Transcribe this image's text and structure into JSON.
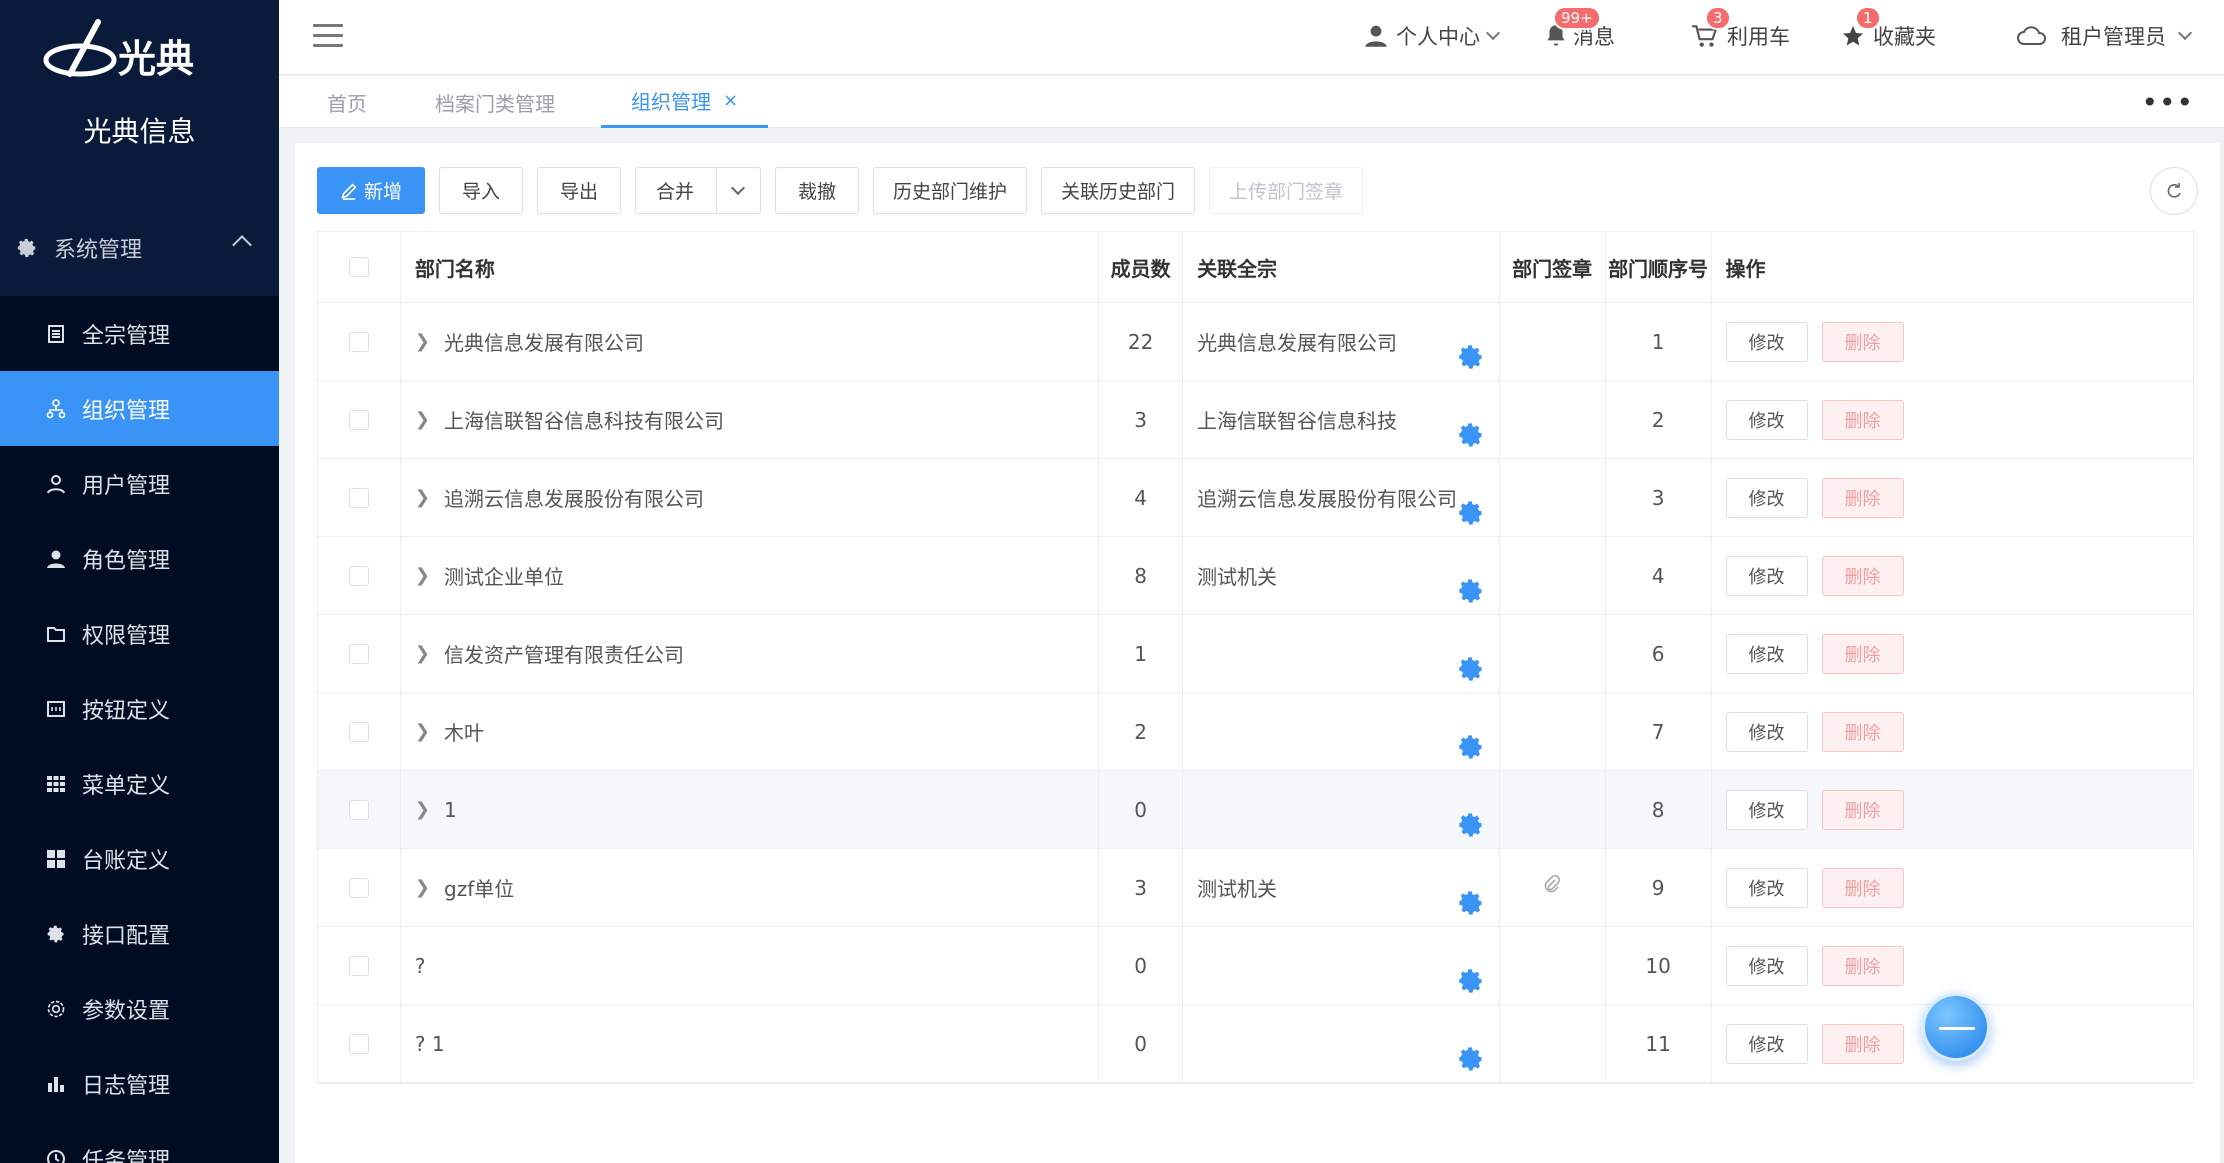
{
  "brand": {
    "logo_text": "光典",
    "name": "光典信息"
  },
  "sidebar": {
    "parent": {
      "label": "系统管理"
    },
    "items": [
      {
        "label": "全宗管理",
        "icon": "document-icon"
      },
      {
        "label": "组织管理",
        "icon": "org-chart-icon",
        "active": true
      },
      {
        "label": "用户管理",
        "icon": "user-outline-icon"
      },
      {
        "label": "角色管理",
        "icon": "user-filled-icon"
      },
      {
        "label": "权限管理",
        "icon": "folder-icon"
      },
      {
        "label": "按钮定义",
        "icon": "button-icon"
      },
      {
        "label": "菜单定义",
        "icon": "grid-icon"
      },
      {
        "label": "台账定义",
        "icon": "tiles-icon"
      },
      {
        "label": "接口配置",
        "icon": "gear-icon"
      },
      {
        "label": "参数设置",
        "icon": "settings-icon"
      },
      {
        "label": "日志管理",
        "icon": "bar-chart-icon"
      },
      {
        "label": "任务管理",
        "icon": "clock-icon"
      }
    ]
  },
  "header": {
    "personal_center": "个人中心",
    "messages": {
      "label": "消息",
      "badge": "99+"
    },
    "cart": {
      "label": "利用车",
      "badge": "3"
    },
    "favorites": {
      "label": "收藏夹",
      "badge": "1"
    },
    "user": "租户管理员"
  },
  "tabs": [
    {
      "label": "首页"
    },
    {
      "label": "档案门类管理"
    },
    {
      "label": "组织管理",
      "active": true
    }
  ],
  "toolbar": {
    "add": "新增",
    "import": "导入",
    "export": "导出",
    "merge": "合并",
    "cut": "裁撤",
    "history_maint": "历史部门维护",
    "link_history": "关联历史部门",
    "upload_seal": "上传部门签章"
  },
  "table": {
    "headers": {
      "name": "部门名称",
      "count": "成员数",
      "fonds": "关联全宗",
      "seal": "部门签章",
      "order": "部门顺序号",
      "ops": "操作"
    },
    "edit_label": "修改",
    "delete_label": "删除",
    "rows": [
      {
        "name": "光典信息发展有限公司",
        "count": "22",
        "fonds": "光典信息发展有限公司",
        "order": "1",
        "expandable": true,
        "seal": false
      },
      {
        "name": "上海信联智谷信息科技有限公司",
        "count": "3",
        "fonds": "上海信联智谷信息科技",
        "order": "2",
        "expandable": true,
        "seal": false
      },
      {
        "name": "追溯云信息发展股份有限公司",
        "count": "4",
        "fonds": "追溯云信息发展股份有限公司",
        "order": "3",
        "expandable": true,
        "seal": false
      },
      {
        "name": "测试企业单位",
        "count": "8",
        "fonds": "测试机关",
        "order": "4",
        "expandable": true,
        "seal": false
      },
      {
        "name": "信发资产管理有限责任公司",
        "count": "1",
        "fonds": "",
        "order": "6",
        "expandable": true,
        "seal": false
      },
      {
        "name": "木叶",
        "count": "2",
        "fonds": "",
        "order": "7",
        "expandable": true,
        "seal": false
      },
      {
        "name": "1",
        "count": "0",
        "fonds": "",
        "order": "8",
        "expandable": true,
        "seal": false,
        "hover": true
      },
      {
        "name": "gzf单位",
        "count": "3",
        "fonds": "测试机关",
        "order": "9",
        "expandable": true,
        "seal": true
      },
      {
        "name": "?",
        "count": "0",
        "fonds": "",
        "order": "10",
        "expandable": false,
        "seal": false
      },
      {
        "name": "? 1",
        "count": "0",
        "fonds": "",
        "order": "11",
        "expandable": false,
        "seal": false
      }
    ]
  },
  "colors": {
    "primary": "#3a94f5",
    "sidebar_bg": "#0a1a3a",
    "danger": "#f56c6c"
  }
}
